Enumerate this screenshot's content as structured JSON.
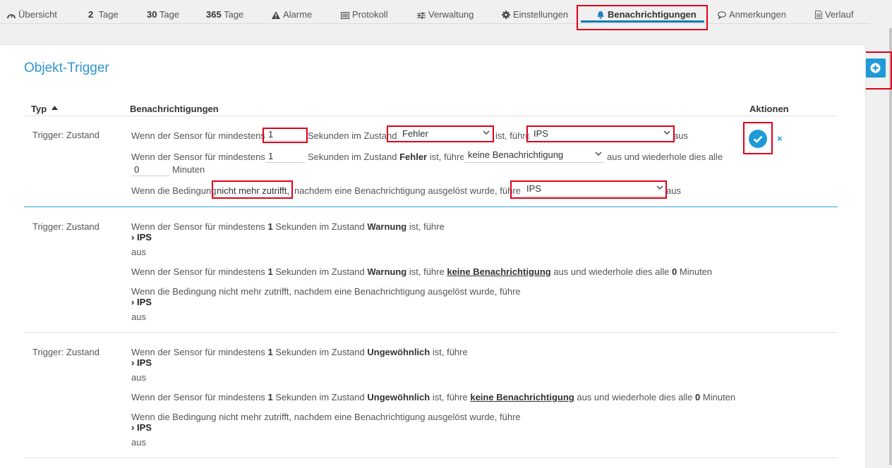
{
  "tabs": [
    {
      "id": "overview",
      "icon": "gauge-icon",
      "label": "Übersicht"
    },
    {
      "id": "2days",
      "num": "2",
      "label": "Tage"
    },
    {
      "id": "30days",
      "num": "30",
      "label": "Tage"
    },
    {
      "id": "365days",
      "num": "365",
      "label": "Tage"
    },
    {
      "id": "alarms",
      "icon": "warning-icon",
      "label": "Alarme"
    },
    {
      "id": "log",
      "icon": "log-icon",
      "label": "Protokoll"
    },
    {
      "id": "manage",
      "icon": "sliders-icon",
      "label": "Verwaltung"
    },
    {
      "id": "settings",
      "icon": "gear-icon",
      "label": "Einstellungen"
    },
    {
      "id": "notifications",
      "icon": "bell-icon",
      "label": "Benachrichtigungen"
    },
    {
      "id": "comments",
      "icon": "speech-bubble-icon",
      "label": "Anmerkungen"
    },
    {
      "id": "history",
      "icon": "document-icon",
      "label": "Verlauf"
    }
  ],
  "colors": {
    "accent": "#2f96cf",
    "button": "#1f9ad6",
    "highlight": "#e0001b"
  },
  "section": {
    "title": "Objekt-Trigger"
  },
  "table": {
    "col_type": "Typ",
    "col_notifications": "Benachrichtigungen",
    "col_actions": "Aktionen"
  },
  "edit_row": {
    "type": "Trigger: Zustand",
    "line1": {
      "pre": "Wenn der Sensor für mindestens",
      "seconds": "1",
      "mid": "Sekunden im Zustand",
      "state": "Fehler",
      "post": "ist, führe",
      "action": "IPS",
      "end": "aus"
    },
    "line2": {
      "pre": "Wenn der Sensor für mindestens",
      "seconds": "1",
      "mid": "Sekunden im Zustand",
      "state": "Fehler",
      "post": "ist, führe",
      "action": "keine Benachrichtigung",
      "end": "aus und wiederhole dies alle",
      "minutes": "0",
      "minutes_label": "Minuten"
    },
    "line3": {
      "pre": "Wenn die Bedingung",
      "condition": "nicht mehr zutrifft,",
      "mid": "nachdem eine Benachrichtigung ausgelöst wurde, führe",
      "action": "IPS",
      "end": "aus"
    },
    "confirm_icon": "checkmark-icon",
    "cancel_label": "×"
  },
  "rows": [
    {
      "type": "Trigger: Zustand",
      "l1_pre": "Wenn der Sensor für mindestens",
      "seconds": "1",
      "l1_mid": "Sekunden im Zustand",
      "state": "Warnung",
      "l1_post": "ist, führe",
      "action": "IPS",
      "out": "aus",
      "l2_pre": "Wenn der Sensor für mindestens",
      "l2_mid": "Sekunden im Zustand",
      "l2_post": "ist, führe",
      "repeat_action": "keine Benachrichtigung",
      "l2_end": "aus und wiederhole dies alle",
      "minutes": "0",
      "minutes_label": "Minuten",
      "l3": "Wenn die Bedingung nicht mehr zutrifft, nachdem eine Benachrichtigung ausgelöst wurde, führe",
      "end_action": "IPS",
      "end_out": "aus"
    },
    {
      "type": "Trigger: Zustand",
      "l1_pre": "Wenn der Sensor für mindestens",
      "seconds": "1",
      "l1_mid": "Sekunden im Zustand",
      "state": "Ungewöhnlich",
      "l1_post": "ist, führe",
      "action": "IPS",
      "out": "aus",
      "l2_pre": "Wenn der Sensor für mindestens",
      "l2_mid": "Sekunden im Zustand",
      "l2_post": "ist, führe",
      "repeat_action": "keine Benachrichtigung",
      "l2_end": "aus und wiederhole dies alle",
      "minutes": "0",
      "minutes_label": "Minuten",
      "l3": "Wenn die Bedingung nicht mehr zutrifft, nachdem eine Benachrichtigung ausgelöst wurde, führe",
      "end_action": "IPS",
      "end_out": "aus"
    }
  ]
}
